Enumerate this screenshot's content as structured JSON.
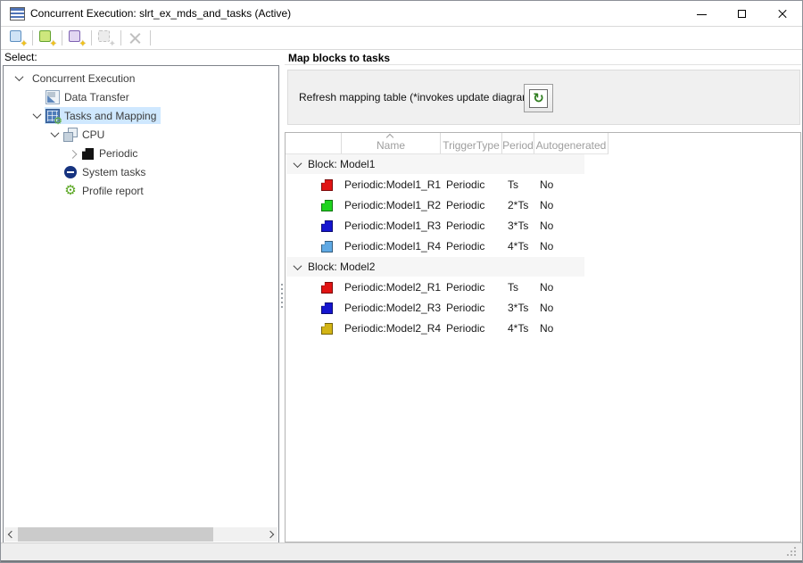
{
  "window": {
    "title": "Concurrent Execution: slrt_ex_mds_and_tasks (Active)"
  },
  "toolbar": {
    "buttons": [
      {
        "name": "new-task",
        "kind": "square-star",
        "fill": "#cfe3f6",
        "border": "#5d8fc0",
        "badge": "#f2c21a",
        "enabled": true
      },
      {
        "name": "new-periodic-trigger",
        "kind": "square-star",
        "fill": "#cde77d",
        "border": "#63a32e",
        "badge": "#f2c21a",
        "enabled": true
      },
      {
        "name": "new-aperiodic-trigger",
        "kind": "square-star",
        "fill": "#e2d6f2",
        "border": "#7e62b2",
        "badge": "#f2c21a",
        "enabled": true
      },
      {
        "name": "map-blocks",
        "kind": "square-star",
        "fill": "#ececec",
        "border": "#c2c2c2",
        "badge": "#d0d0d0",
        "enabled": false
      },
      {
        "name": "delete",
        "kind": "x",
        "fill": "",
        "border": "",
        "badge": "",
        "enabled": false
      }
    ]
  },
  "left_panel": {
    "label": "Select:",
    "tree": [
      {
        "label": "Concurrent Execution",
        "level": 0,
        "chevron": "down",
        "icon": null,
        "selected": false
      },
      {
        "label": "Data Transfer",
        "level": 1,
        "chevron": null,
        "icon": "data-transfer",
        "selected": false
      },
      {
        "label": "Tasks and Mapping",
        "level": 1,
        "chevron": "down",
        "icon": "tasks-mapping",
        "selected": true
      },
      {
        "label": "CPU",
        "level": 2,
        "chevron": "down",
        "icon": "cpu",
        "selected": false
      },
      {
        "label": "Periodic",
        "level": 3,
        "chevron": "right",
        "icon": "periodic",
        "selected": false
      },
      {
        "label": "System tasks",
        "level": 2,
        "chevron": null,
        "icon": "system-tasks",
        "selected": false
      },
      {
        "label": "Profile report",
        "level": 2,
        "chevron": null,
        "icon": "profile-report",
        "selected": false
      }
    ]
  },
  "right_panel": {
    "title": "Map blocks to tasks",
    "refresh_label": "Refresh mapping table (*invokes update diagram)",
    "refresh_glyph": "↻"
  },
  "table": {
    "columns": [
      "",
      "Name",
      "TriggerType",
      "Period",
      "Autogenerated"
    ],
    "sorted_column": "Name",
    "groups": [
      {
        "label": "Block: Model1",
        "rows": [
          {
            "color": "#e11414",
            "name": "Periodic:Model1_R1",
            "trigger_type": "Periodic",
            "period": "Ts",
            "autogenerated": "No"
          },
          {
            "color": "#1ed31e",
            "name": "Periodic:Model1_R2",
            "trigger_type": "Periodic",
            "period": "2*Ts",
            "autogenerated": "No"
          },
          {
            "color": "#1515cf",
            "name": "Periodic:Model1_R3",
            "trigger_type": "Periodic",
            "period": "3*Ts",
            "autogenerated": "No"
          },
          {
            "color": "#5fa9e4",
            "name": "Periodic:Model1_R4",
            "trigger_type": "Periodic",
            "period": "4*Ts",
            "autogenerated": "No"
          }
        ]
      },
      {
        "label": "Block: Model2",
        "rows": [
          {
            "color": "#e11414",
            "name": "Periodic:Model2_R1",
            "trigger_type": "Periodic",
            "period": "Ts",
            "autogenerated": "No"
          },
          {
            "color": "#1515cf",
            "name": "Periodic:Model2_R3",
            "trigger_type": "Periodic",
            "period": "3*Ts",
            "autogenerated": "No"
          },
          {
            "color": "#d3b414",
            "name": "Periodic:Model2_R4",
            "trigger_type": "Periodic",
            "period": "4*Ts",
            "autogenerated": "No"
          }
        ]
      }
    ]
  }
}
